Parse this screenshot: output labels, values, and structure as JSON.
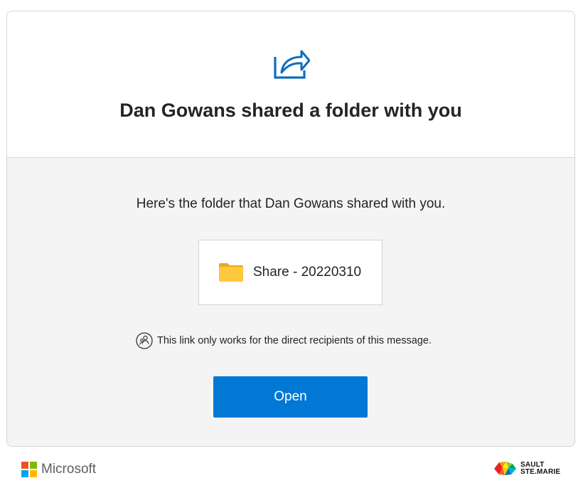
{
  "header": {
    "title": "Dan Gowans shared a folder with you",
    "icon": "share-icon"
  },
  "body": {
    "message": "Here's the folder that Dan Gowans shared with you.",
    "folder": {
      "icon": "folder-icon",
      "name": "Share - 20220310"
    },
    "notice": {
      "icon": "people-icon",
      "text": "This link only works for the direct recipients of this message."
    },
    "open_button_label": "Open"
  },
  "footer": {
    "brand_name": "Microsoft",
    "partner_logo_lines": [
      "SAULT",
      "STE.MARIE"
    ]
  },
  "colors": {
    "accent": "#0078d4",
    "folder": "#ffc83d",
    "ms_red": "#f25022",
    "ms_green": "#7fba00",
    "ms_blue": "#00a4ef",
    "ms_yellow": "#ffb900"
  }
}
